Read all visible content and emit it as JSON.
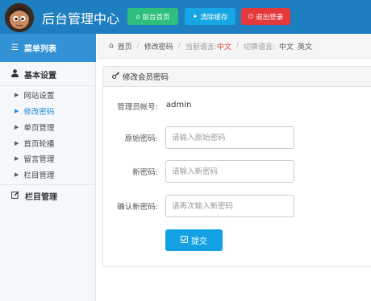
{
  "header": {
    "title": "后台管理中心",
    "buttons": {
      "home": "前台首页",
      "clear_cache": "清除缓存",
      "logout": "退出登录"
    }
  },
  "sidebar": {
    "heading": "菜单列表",
    "group_basic": "基本设置",
    "items": [
      "网站设置",
      "修改密码",
      "单页管理",
      "首页轮播",
      "留言管理",
      "栏目管理"
    ],
    "active_item": "修改密码",
    "group_column": "栏目管理"
  },
  "breadcrumb": {
    "home": "首页",
    "current_page": "修改密码",
    "current_lang_label": "当前语言:",
    "current_lang_value": "中文",
    "switch_lang_label": "切换语言:",
    "lang_options": [
      "中文",
      "英文"
    ]
  },
  "panel": {
    "title": "修改会员密码"
  },
  "form": {
    "admin_label": "管理员帐号:",
    "admin_value": "admin",
    "old_password": {
      "label": "原始密码:",
      "placeholder": "请输入原始密码"
    },
    "new_password": {
      "label": "新密码:",
      "placeholder": "请输入新密码"
    },
    "confirm_password": {
      "label": "确认新密码:",
      "placeholder": "请再次输入新密码"
    },
    "submit_label": "提交"
  },
  "colors": {
    "header_bg": "#1e7fc0",
    "sidebar_head_bg": "#3292d4",
    "btn_home": "#2ebf7a",
    "btn_cache": "#16a6e4",
    "btn_logout": "#e5383b",
    "active_link": "#1e88d6",
    "submit": "#13a1e4"
  },
  "icons": {
    "home_button": "home-icon",
    "cache_button": "wrench-icon",
    "logout_button": "power-icon",
    "sidebar_head": "list-icon",
    "basic_group": "user-icon",
    "column_group": "edit-icon",
    "breadcrumb_home": "home-icon",
    "panel_head": "key-icon",
    "submit": "check-square-icon"
  }
}
